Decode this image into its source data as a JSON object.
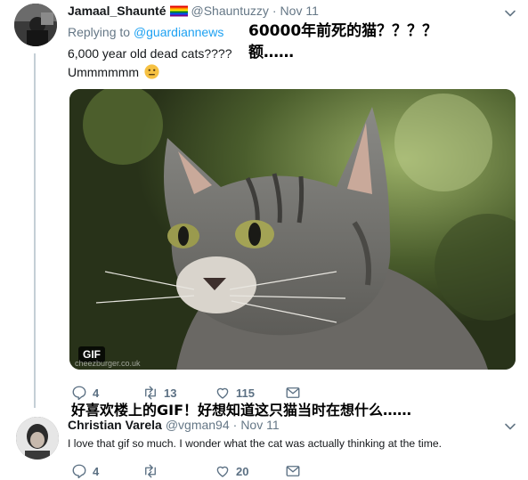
{
  "tweet1": {
    "display_name": "Jamaal_Shaunté",
    "handle": "@Shauntuzzy",
    "separator": "·",
    "date": "Nov 11",
    "replying_prefix": "Replying to",
    "replying_handle": "@guardiannews",
    "line1": "6,000 year old dead cats????",
    "line2": "Ummmmmm",
    "emoji": "😐",
    "media_badge": "GIF",
    "watermark": "cheezburger.co.uk",
    "actions": {
      "reply_count": "4",
      "retweet_count": "13",
      "like_count": "115"
    }
  },
  "annotations": {
    "top_line1": "60000年前死的猫？？？？",
    "top_line2": "额……",
    "middle": "好喜欢楼上的GIF！好想知道这只猫当时在想什么……"
  },
  "tweet2": {
    "display_name": "Christian Varela",
    "handle": "@vgman94",
    "separator": "·",
    "date": "Nov 11",
    "text": "I love that gif so much. I wonder what the cat was actually thinking at the time.",
    "actions": {
      "reply_count": "4",
      "retweet_count": "",
      "like_count": "20"
    }
  },
  "colors": {
    "link": "#1da1f2",
    "muted": "#657786",
    "thread_line": "#c4cfd6"
  },
  "icons": [
    "chevron-down-icon",
    "reply-icon",
    "retweet-icon",
    "like-icon",
    "share-icon",
    "rainbow-flag-icon",
    "neutral-face-emoji"
  ]
}
